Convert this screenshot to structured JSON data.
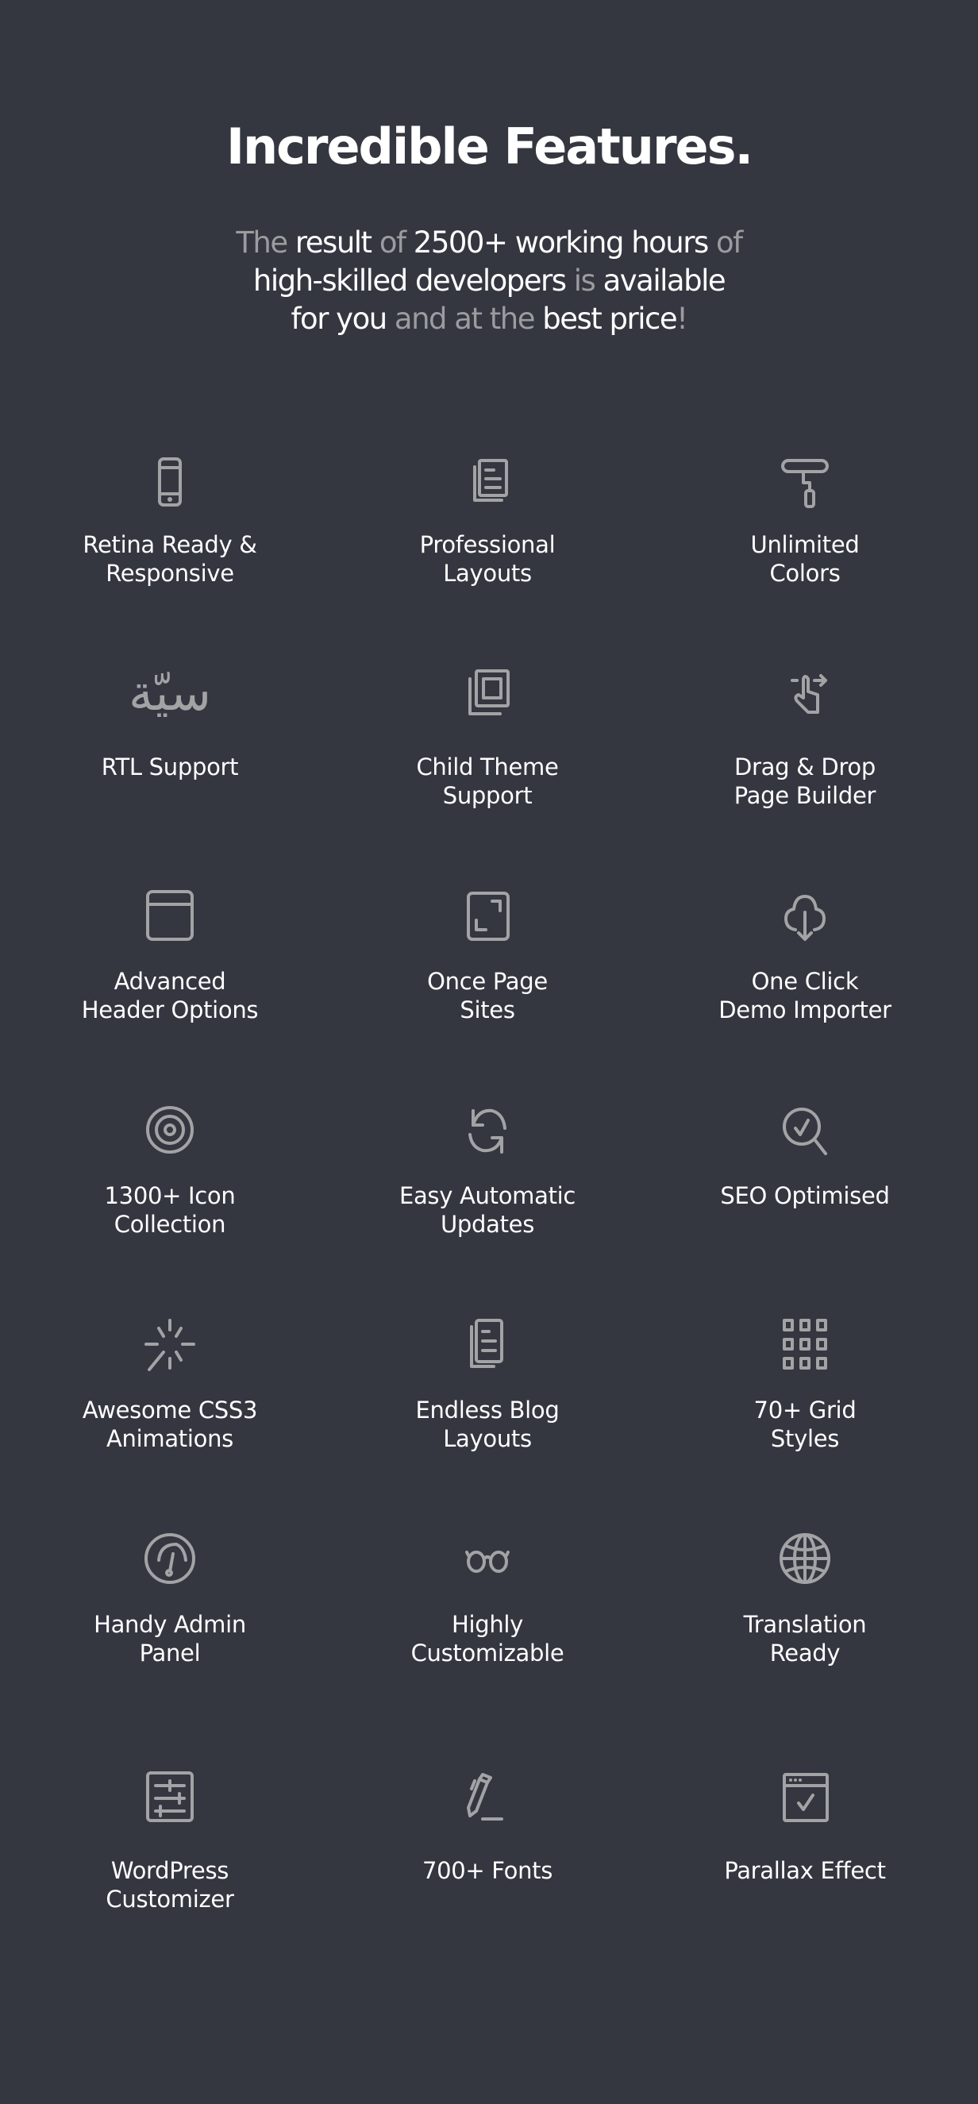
{
  "section": {
    "title": "Incredible Features.",
    "subtitle_segments": [
      {
        "text": "The ",
        "tone": "muted"
      },
      {
        "text": "result ",
        "tone": "bright"
      },
      {
        "text": "of ",
        "tone": "muted"
      },
      {
        "text": "2500+ working hours ",
        "tone": "bright"
      },
      {
        "text": "of",
        "tone": "muted"
      },
      {
        "text": "\n",
        "tone": "break"
      },
      {
        "text": "high-skilled developers ",
        "tone": "bright"
      },
      {
        "text": "is ",
        "tone": "muted"
      },
      {
        "text": "available",
        "tone": "bright"
      },
      {
        "text": "\n",
        "tone": "break"
      },
      {
        "text": "for you ",
        "tone": "bright"
      },
      {
        "text": "and at the ",
        "tone": "muted"
      },
      {
        "text": "best price",
        "tone": "bright"
      },
      {
        "text": "!",
        "tone": "muted"
      }
    ]
  },
  "colors": {
    "background": "#343640",
    "icon": "#a1a3a5",
    "text_bright": "#ffffff",
    "text_muted": "#9b9c9f"
  },
  "features": [
    {
      "label": "Retina Ready &\nResponsive",
      "icon": "mobile-phone-icon"
    },
    {
      "label": "Professional\nLayouts",
      "icon": "documents-icon"
    },
    {
      "label": "Unlimited\nColors",
      "icon": "paint-roller-icon"
    },
    {
      "label": "RTL Support",
      "icon": "arabic-script-icon",
      "glyph": "سيّة"
    },
    {
      "label": "Child Theme\nSupport",
      "icon": "stacked-layers-icon"
    },
    {
      "label": "Drag & Drop\nPage Builder",
      "icon": "swipe-hand-icon"
    },
    {
      "label": "Advanced\nHeader Options",
      "icon": "browser-header-icon"
    },
    {
      "label": "Once Page\nSites",
      "icon": "expand-frame-icon"
    },
    {
      "label": "One Click\nDemo Importer",
      "icon": "cloud-download-icon"
    },
    {
      "label": "1300+ Icon\nCollection",
      "icon": "target-icon"
    },
    {
      "label": "Easy Automatic\nUpdates",
      "icon": "refresh-icon"
    },
    {
      "label": "SEO Optimised",
      "icon": "search-check-icon"
    },
    {
      "label": "Awesome CSS3\nAnimations",
      "icon": "sparkle-icon"
    },
    {
      "label": "Endless Blog\nLayouts",
      "icon": "blog-pages-icon"
    },
    {
      "label": "70+ Grid\nStyles",
      "icon": "grid-icon"
    },
    {
      "label": "Handy Admin\nPanel",
      "icon": "gauge-icon"
    },
    {
      "label": "Highly\nCustomizable",
      "icon": "glasses-icon"
    },
    {
      "label": "Translation\nReady",
      "icon": "globe-icon"
    },
    {
      "label": "WordPress\nCustomizer",
      "icon": "sliders-icon"
    },
    {
      "label": "700+ Fonts",
      "icon": "pen-icon"
    },
    {
      "label": "Parallax Effect",
      "icon": "browser-check-icon"
    }
  ]
}
